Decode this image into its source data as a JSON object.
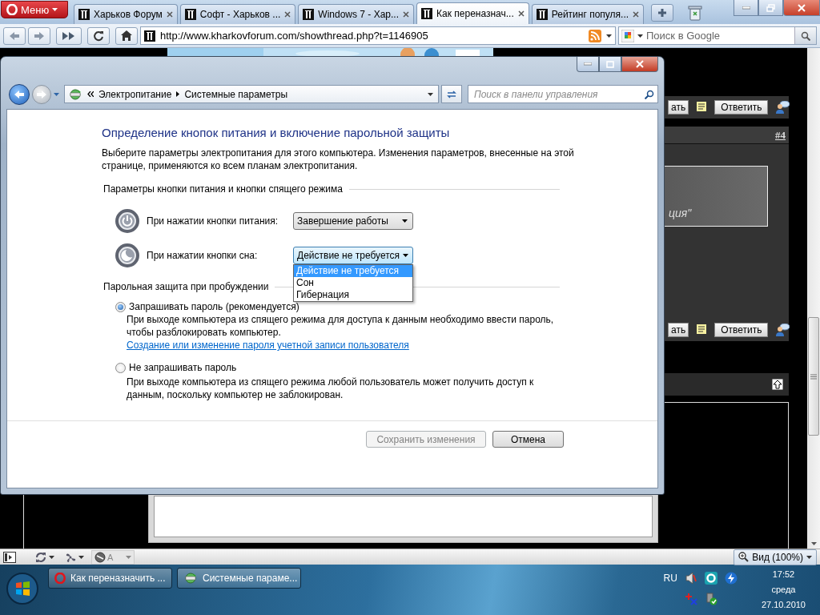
{
  "browser": {
    "menu": "Меню",
    "tabs": [
      {
        "title": "Харьков Форум",
        "selected": false
      },
      {
        "title": "Софт - Харьков ...",
        "selected": false
      },
      {
        "title": "Windows 7 - Хар...",
        "selected": false
      },
      {
        "title": "Как переназнач...",
        "selected": true
      },
      {
        "title": "Рейтинг популя...",
        "selected": false
      }
    ],
    "address": "http://www.kharkovforum.com/showthread.php?t=1146905",
    "search": {
      "placeholder": "Поиск в Google"
    }
  },
  "forum": {
    "action_rows": [
      {
        "partial_button": "ать",
        "reply_button": "Ответить"
      },
      {
        "partial_button": "ать",
        "reply_button": "Ответить"
      }
    ],
    "post_number": "#4",
    "quote": "ция\""
  },
  "window": {
    "breadcrumb": [
      "Электропитание",
      "Системные параметры"
    ],
    "search": {
      "placeholder": "Поиск в панели управления"
    },
    "heading": "Определение кнопок питания и включение парольной защиты",
    "description": "Выберите параметры электропитания для этого компьютера. Изменения параметров, внесенные на этой странице, применяются ко всем планам электропитания.",
    "power_section": {
      "title": "Параметры кнопки питания и кнопки спящего режима",
      "rows": [
        {
          "kind": "power",
          "label": "При нажатии кнопки питания:",
          "value": "Завершение работы",
          "expanded": false
        },
        {
          "kind": "sleep",
          "label": "При нажатии кнопки сна:",
          "value": "Действие не требуется",
          "expanded": true,
          "options": [
            {
              "label": "Действие не требуется",
              "selected": true
            },
            {
              "label": "Сон",
              "selected": false
            },
            {
              "label": "Гибернация",
              "selected": false
            }
          ]
        }
      ]
    },
    "password_section": {
      "title": "Парольная защита при пробуждении",
      "options": [
        {
          "label": "Запрашивать пароль (рекомендуется)",
          "selected": true,
          "description": "При выходе компьютера из спящего режима для доступа к данным необходимо ввести пароль, чтобы разблокировать компьютер.",
          "link": "Создание или изменение пароля учетной записи пользователя"
        },
        {
          "label": "Не запрашивать пароль",
          "selected": false,
          "description": "При выходе компьютера из спящего режима любой пользователь может получить доступ к данным, поскольку компьютер не заблокирован."
        }
      ]
    },
    "buttons": [
      {
        "label": "Сохранить изменения",
        "disabled": true
      },
      {
        "label": "Отмена",
        "disabled": false
      }
    ]
  },
  "status_bar": {
    "speed_label": "A",
    "zoom": "Вид (100%)"
  },
  "taskbar": {
    "items": [
      {
        "kind": "opera",
        "label": "Как переназначить ..."
      },
      {
        "kind": "control-panel",
        "label": "Системные параме..."
      }
    ],
    "language": "RU",
    "time": "17:52",
    "day": "среда",
    "date": "27.10.2010"
  }
}
